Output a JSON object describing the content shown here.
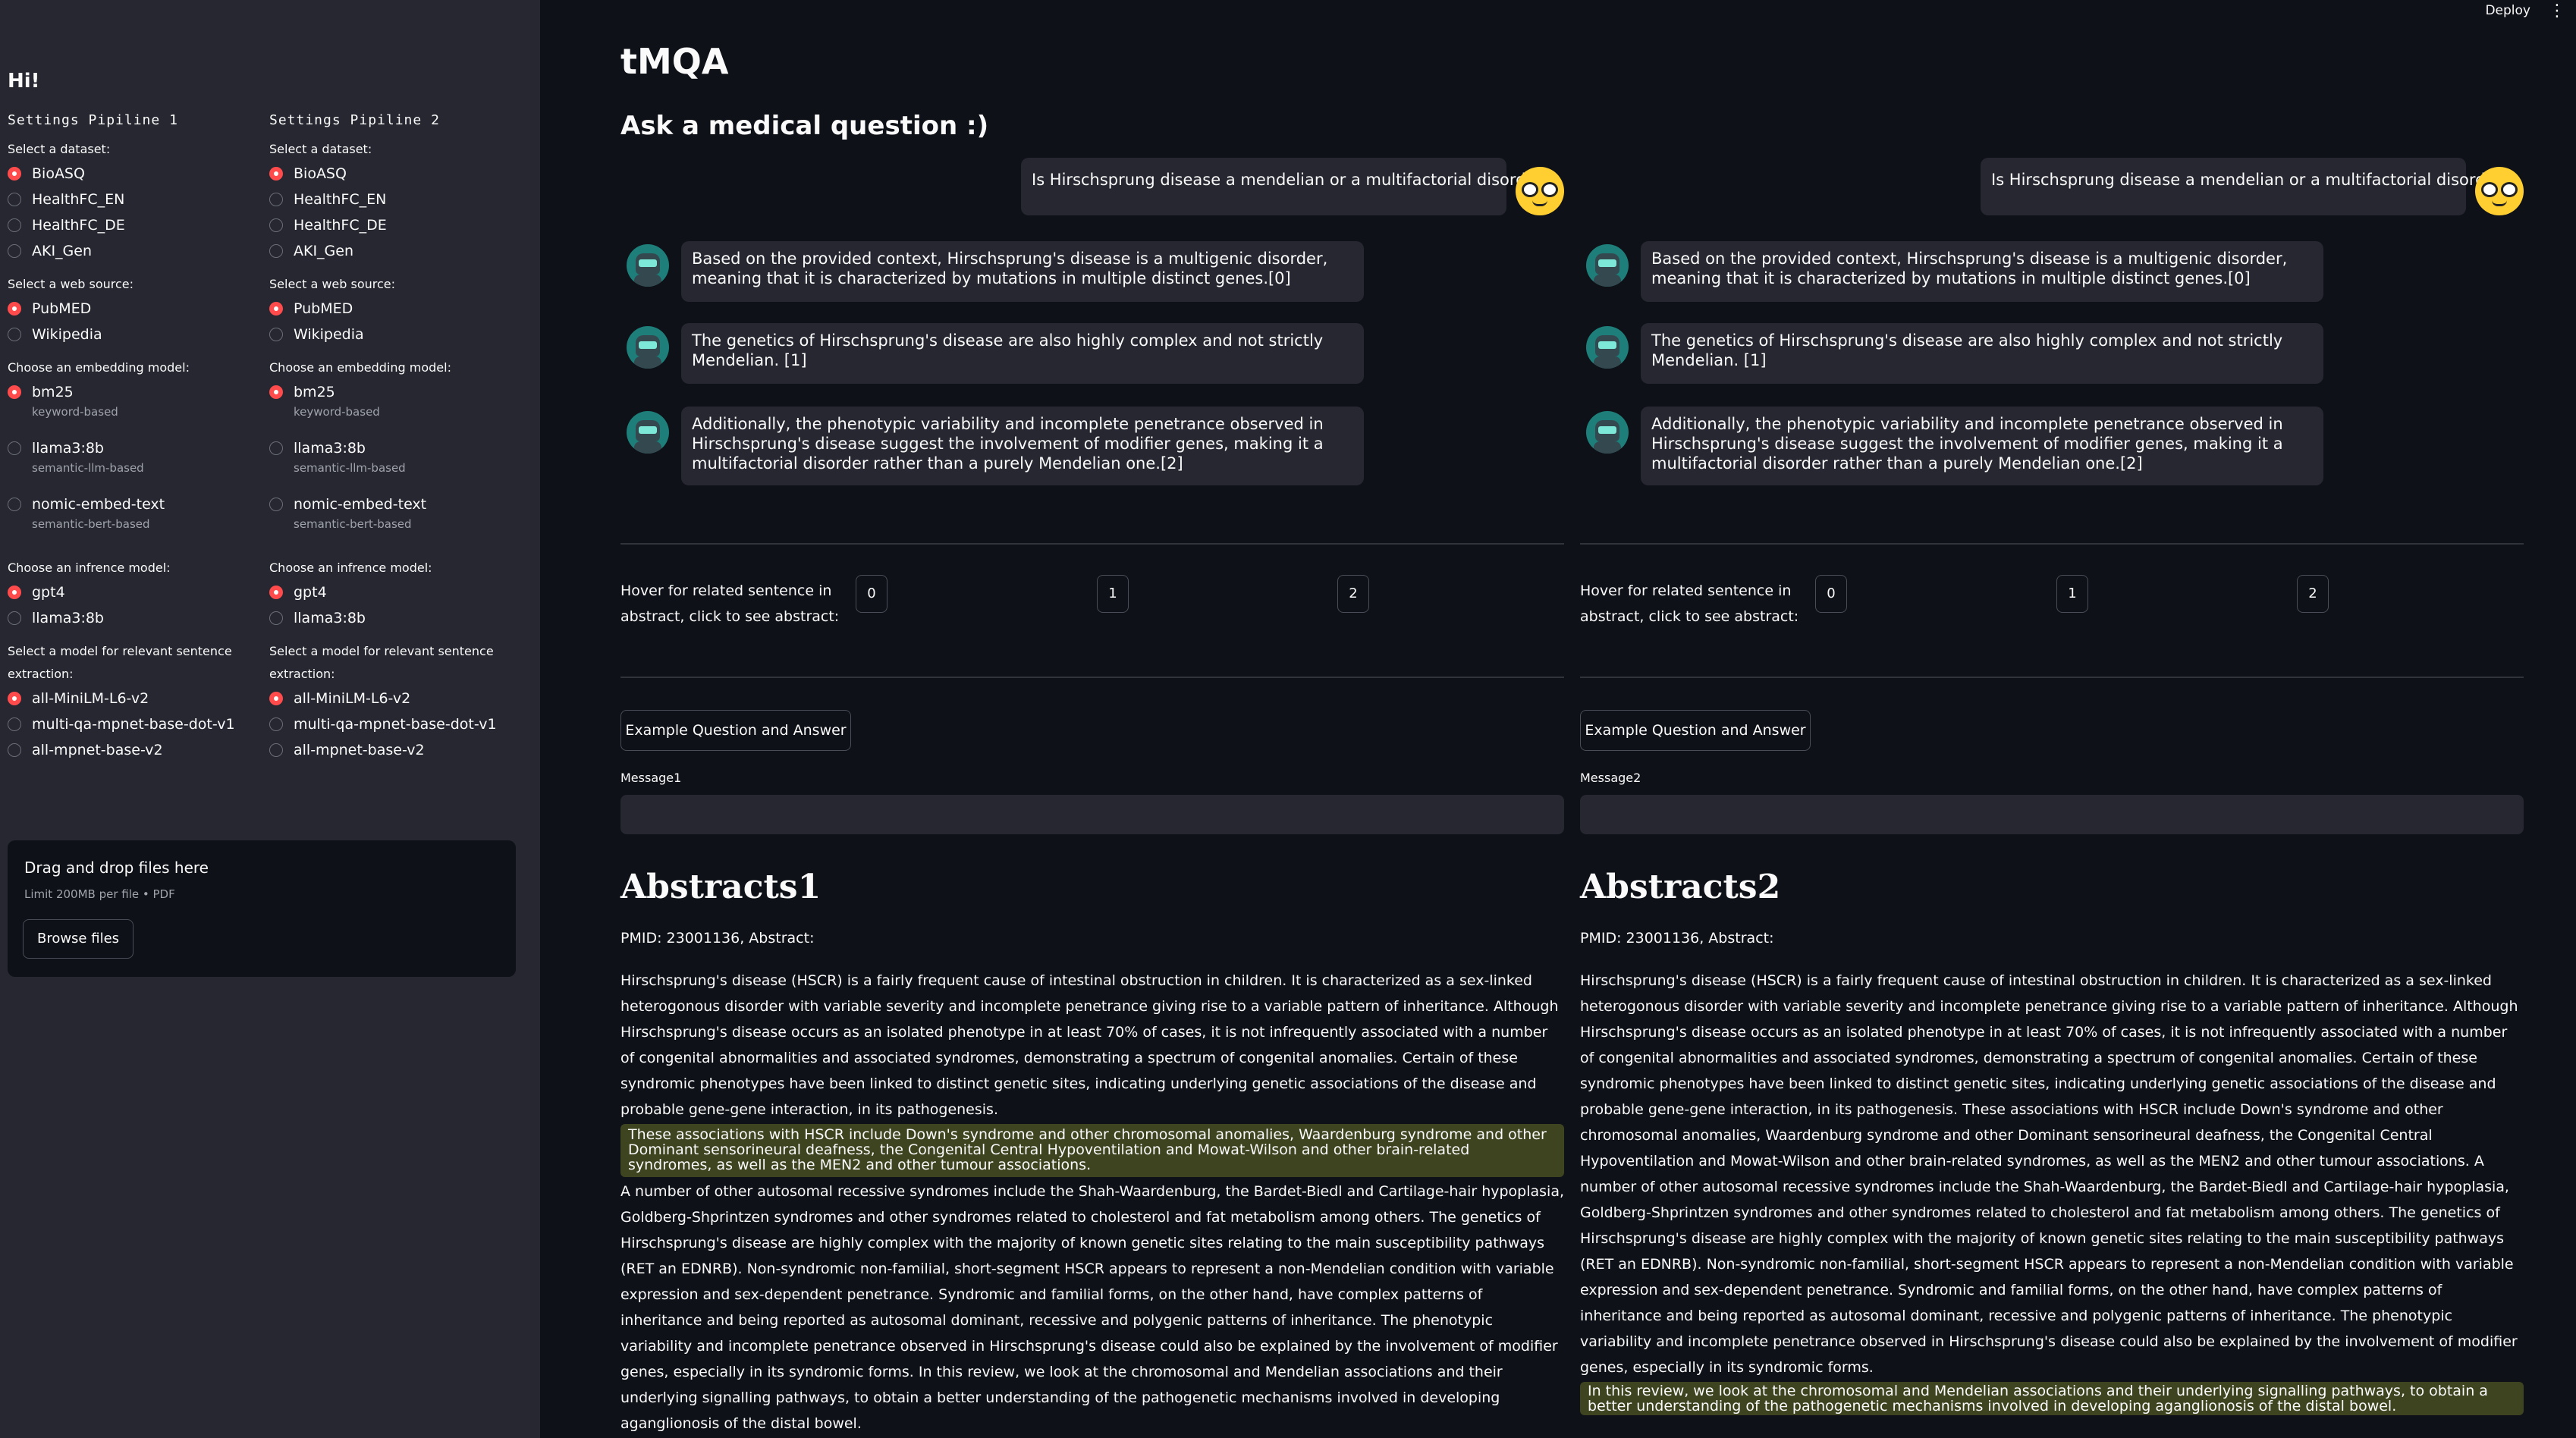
{
  "header": {
    "deploy_label": "Deploy",
    "menu_icon": "⋮"
  },
  "sidebar": {
    "greeting": "Hi!",
    "pipelines": [
      {
        "title": "Settings Pipiline 1",
        "groups": [
          {
            "label": "Select a dataset:",
            "options": [
              {
                "label": "BioASQ",
                "selected": true,
                "caption": ""
              },
              {
                "label": "HealthFC_EN",
                "selected": false,
                "caption": ""
              },
              {
                "label": "HealthFC_DE",
                "selected": false,
                "caption": ""
              },
              {
                "label": "AKI_Gen",
                "selected": false,
                "caption": ""
              }
            ]
          },
          {
            "label": "Select a web source:",
            "options": [
              {
                "label": "PubMED",
                "selected": true,
                "caption": ""
              },
              {
                "label": "Wikipedia",
                "selected": false,
                "caption": ""
              }
            ]
          },
          {
            "label": "Choose an embedding model:",
            "options": [
              {
                "label": "bm25",
                "selected": true,
                "caption": "keyword-based"
              },
              {
                "label": "llama3:8b",
                "selected": false,
                "caption": "semantic-llm-based"
              },
              {
                "label": "nomic-embed-text",
                "selected": false,
                "caption": "semantic-bert-based"
              }
            ]
          },
          {
            "label": "Choose an infrence model:",
            "options": [
              {
                "label": "gpt4",
                "selected": true,
                "caption": ""
              },
              {
                "label": "llama3:8b",
                "selected": false,
                "caption": ""
              }
            ]
          },
          {
            "label": "Select a model for relevant sentence extraction:",
            "options": [
              {
                "label": "all-MiniLM-L6-v2",
                "selected": true,
                "caption": ""
              },
              {
                "label": "multi-qa-mpnet-base-dot-v1",
                "selected": false,
                "caption": ""
              },
              {
                "label": "all-mpnet-base-v2",
                "selected": false,
                "caption": ""
              }
            ]
          }
        ]
      },
      {
        "title": "Settings Pipiline 2",
        "groups": [
          {
            "label": "Select a dataset:",
            "options": [
              {
                "label": "BioASQ",
                "selected": true,
                "caption": ""
              },
              {
                "label": "HealthFC_EN",
                "selected": false,
                "caption": ""
              },
              {
                "label": "HealthFC_DE",
                "selected": false,
                "caption": ""
              },
              {
                "label": "AKI_Gen",
                "selected": false,
                "caption": ""
              }
            ]
          },
          {
            "label": "Select a web source:",
            "options": [
              {
                "label": "PubMED",
                "selected": true,
                "caption": ""
              },
              {
                "label": "Wikipedia",
                "selected": false,
                "caption": ""
              }
            ]
          },
          {
            "label": "Choose an embedding model:",
            "options": [
              {
                "label": "bm25",
                "selected": true,
                "caption": "keyword-based"
              },
              {
                "label": "llama3:8b",
                "selected": false,
                "caption": "semantic-llm-based"
              },
              {
                "label": "nomic-embed-text",
                "selected": false,
                "caption": "semantic-bert-based"
              }
            ]
          },
          {
            "label": "Choose an infrence model:",
            "options": [
              {
                "label": "gpt4",
                "selected": true,
                "caption": ""
              },
              {
                "label": "llama3:8b",
                "selected": false,
                "caption": ""
              }
            ]
          },
          {
            "label": "Select a model for relevant sentence extraction:",
            "options": [
              {
                "label": "all-MiniLM-L6-v2",
                "selected": true,
                "caption": ""
              },
              {
                "label": "multi-qa-mpnet-base-dot-v1",
                "selected": false,
                "caption": ""
              },
              {
                "label": "all-mpnet-base-v2",
                "selected": false,
                "caption": ""
              }
            ]
          }
        ]
      }
    ],
    "upload": {
      "title": "Drag and drop files here",
      "subtitle": "Limit 200MB per file • PDF",
      "button": "Browse files"
    }
  },
  "main": {
    "title": "tMQA",
    "subtitle": "Ask a medical question :)",
    "panes": [
      {
        "question": "Is Hirschsprung disease a mendelian or a multifactorial disorder?",
        "answers": [
          "Based on the provided context, Hirschsprung's disease is a multigenic disorder, meaning that it is characterized by mutations in multiple distinct genes.[0]",
          "The genetics of Hirschsprung's disease are also highly complex and not strictly Mendelian. [1]",
          "Additionally, the phenotypic variability and incomplete penetrance observed in Hirschsprung's disease suggest the involvement of modifier genes, making it a multifactorial disorder rather than a purely Mendelian one.[2]"
        ],
        "hover_label": "Hover for related sentence in abstract, click to see abstract:",
        "ref_buttons": [
          "0",
          "1",
          "2"
        ],
        "example_button": "Example Question and Answer",
        "message_label": "Message1",
        "abstracts_title": "Abstracts1",
        "pmid": "PMID: 23001136, Abstract:",
        "abstract_before": "Hirschsprung's disease (HSCR) is a fairly frequent cause of intestinal obstruction in children. It is characterized as a sex-linked heterogonous disorder with variable severity and incomplete penetrance giving rise to a variable pattern of inheritance. Although Hirschsprung's disease occurs as an isolated phenotype in at least 70% of cases, it is not infrequently associated with a number of congenital abnormalities and associated syndromes, demonstrating a spectrum of congenital anomalies. Certain of these syndromic phenotypes have been linked to distinct genetic sites, indicating underlying genetic associations of the disease and probable gene-gene interaction, in its pathogenesis.",
        "abstract_highlight": "These associations with HSCR include Down's syndrome and other chromosomal anomalies, Waardenburg syndrome and other Dominant sensorineural deafness, the Congenital Central Hypoventilation and Mowat-Wilson and other brain-related syndromes, as well as the MEN2 and other tumour associations.",
        "abstract_after": "A number of other autosomal recessive syndromes include the Shah-Waardenburg, the Bardet-Biedl and Cartilage-hair hypoplasia, Goldberg-Shprintzen syndromes and other syndromes related to cholesterol and fat metabolism among others. The genetics of Hirschsprung's disease are highly complex with the majority of known genetic sites relating to the main susceptibility pathways (RET an EDNRB). Non-syndromic non-familial, short-segment HSCR appears to represent a non-Mendelian condition with variable expression and sex-dependent penetrance. Syndromic and familial forms, on the other hand, have complex patterns of inheritance and being reported as autosomal dominant, recessive and polygenic patterns of inheritance. The phenotypic variability and incomplete penetrance observed in Hirschsprung's disease could also be explained by the involvement of modifier genes, especially in its syndromic forms. In this review, we look at the chromosomal and Mendelian associations and their underlying signalling pathways, to obtain a better understanding of the pathogenetic mechanisms involved in developing aganglionosis of the distal bowel."
      },
      {
        "question": "Is Hirschsprung disease a mendelian or a multifactorial disorder?",
        "answers": [
          "Based on the provided context, Hirschsprung's disease is a multigenic disorder, meaning that it is characterized by mutations in multiple distinct genes.[0]",
          "The genetics of Hirschsprung's disease are also highly complex and not strictly Mendelian. [1]",
          "Additionally, the phenotypic variability and incomplete penetrance observed in Hirschsprung's disease suggest the involvement of modifier genes, making it a multifactorial disorder rather than a purely Mendelian one.[2]"
        ],
        "hover_label": "Hover for related sentence in abstract, click to see abstract:",
        "ref_buttons": [
          "0",
          "1",
          "2"
        ],
        "example_button": "Example Question and Answer",
        "message_label": "Message2",
        "abstracts_title": "Abstracts2",
        "pmid": "PMID: 23001136, Abstract:",
        "abstract_before": "Hirschsprung's disease (HSCR) is a fairly frequent cause of intestinal obstruction in children. It is characterized as a sex-linked heterogonous disorder with variable severity and incomplete penetrance giving rise to a variable pattern of inheritance. Although Hirschsprung's disease occurs as an isolated phenotype in at least 70% of cases, it is not infrequently associated with a number of congenital abnormalities and associated syndromes, demonstrating a spectrum of congenital anomalies. Certain of these syndromic phenotypes have been linked to distinct genetic sites, indicating underlying genetic associations of the disease and probable gene-gene interaction, in its pathogenesis. These associations with HSCR include Down's syndrome and other chromosomal anomalies, Waardenburg syndrome and other Dominant sensorineural deafness, the Congenital Central Hypoventilation and Mowat-Wilson and other brain-related syndromes, as well as the MEN2 and other tumour associations. A number of other autosomal recessive syndromes include the Shah-Waardenburg, the Bardet-Biedl and Cartilage-hair hypoplasia, Goldberg-Shprintzen syndromes and other syndromes related to cholesterol and fat metabolism among others. The genetics of Hirschsprung's disease are highly complex with the majority of known genetic sites relating to the main susceptibility pathways (RET an EDNRB). Non-syndromic non-familial, short-segment HSCR appears to represent a non-Mendelian condition with variable expression and sex-dependent penetrance. Syndromic and familial forms, on the other hand, have complex patterns of inheritance and being reported as autosomal dominant, recessive and polygenic patterns of inheritance. The phenotypic variability and incomplete penetrance observed in Hirschsprung's disease could also be explained by the involvement of modifier genes, especially in its syndromic forms.",
        "abstract_highlight": "In this review, we look at the chromosomal and Mendelian associations and their underlying signalling pathways, to obtain a better understanding of the pathogenetic mechanisms involved in developing aganglionosis of the distal bowel.",
        "abstract_after": ""
      }
    ]
  },
  "colors": {
    "background": "#0e1117",
    "sidebar": "#262730",
    "accent": "#ff4b4b",
    "highlight": "#3e4420"
  }
}
